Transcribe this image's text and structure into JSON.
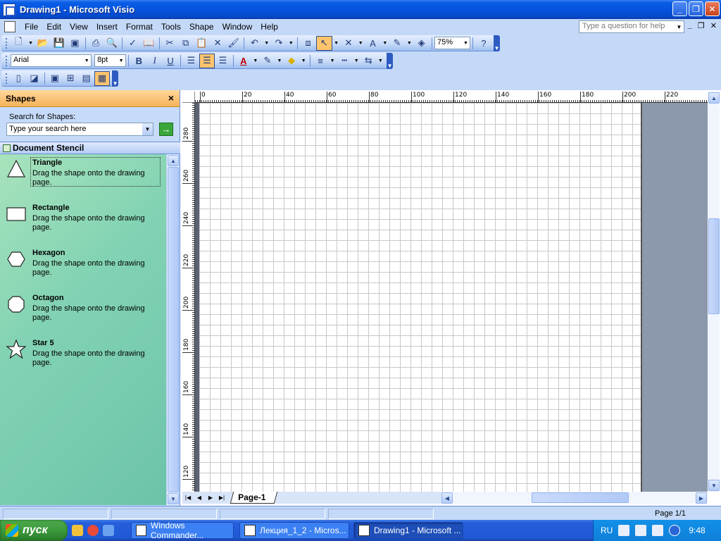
{
  "window": {
    "title": "Drawing1 - Microsoft Visio",
    "minimize": "_",
    "maximize": "❐",
    "close": "✕"
  },
  "menu": {
    "items": [
      "File",
      "Edit",
      "View",
      "Insert",
      "Format",
      "Tools",
      "Shape",
      "Window",
      "Help"
    ],
    "help_placeholder": "Type a question for help"
  },
  "toolbar": {
    "zoom": "75%",
    "font": "Arial",
    "font_size": "8pt",
    "bold": "B",
    "italic": "I",
    "underline": "U",
    "text_tool": "A"
  },
  "shapes_pane": {
    "title": "Shapes",
    "search_label": "Search for Shapes:",
    "search_placeholder": "Type your search here",
    "stencil_title": "Document Stencil",
    "masters": [
      {
        "name": "Triangle",
        "description": "Drag the shape onto the drawing page."
      },
      {
        "name": "Rectangle",
        "description": "Drag the shape onto the drawing page."
      },
      {
        "name": "Hexagon",
        "description": "Drag the shape onto the drawing page."
      },
      {
        "name": "Octagon",
        "description": "Drag the shape onto the drawing page."
      },
      {
        "name": "Star 5",
        "description": "Drag the shape onto the drawing page."
      }
    ]
  },
  "rulers": {
    "horizontal": [
      "0",
      "20",
      "40",
      "60",
      "80",
      "100",
      "120",
      "140",
      "160",
      "180",
      "200",
      "220"
    ],
    "vertical": [
      "280",
      "260",
      "240",
      "220",
      "200",
      "180",
      "160",
      "140",
      "120"
    ]
  },
  "page_tab": "Page-1",
  "status": {
    "page": "Page 1/1"
  },
  "taskbar": {
    "start": "пуск",
    "tasks": [
      "Windows Commander...",
      "Лекция_1_2 - Micros...",
      "Drawing1 - Microsoft ..."
    ],
    "lang": "RU",
    "time": "9:48"
  }
}
